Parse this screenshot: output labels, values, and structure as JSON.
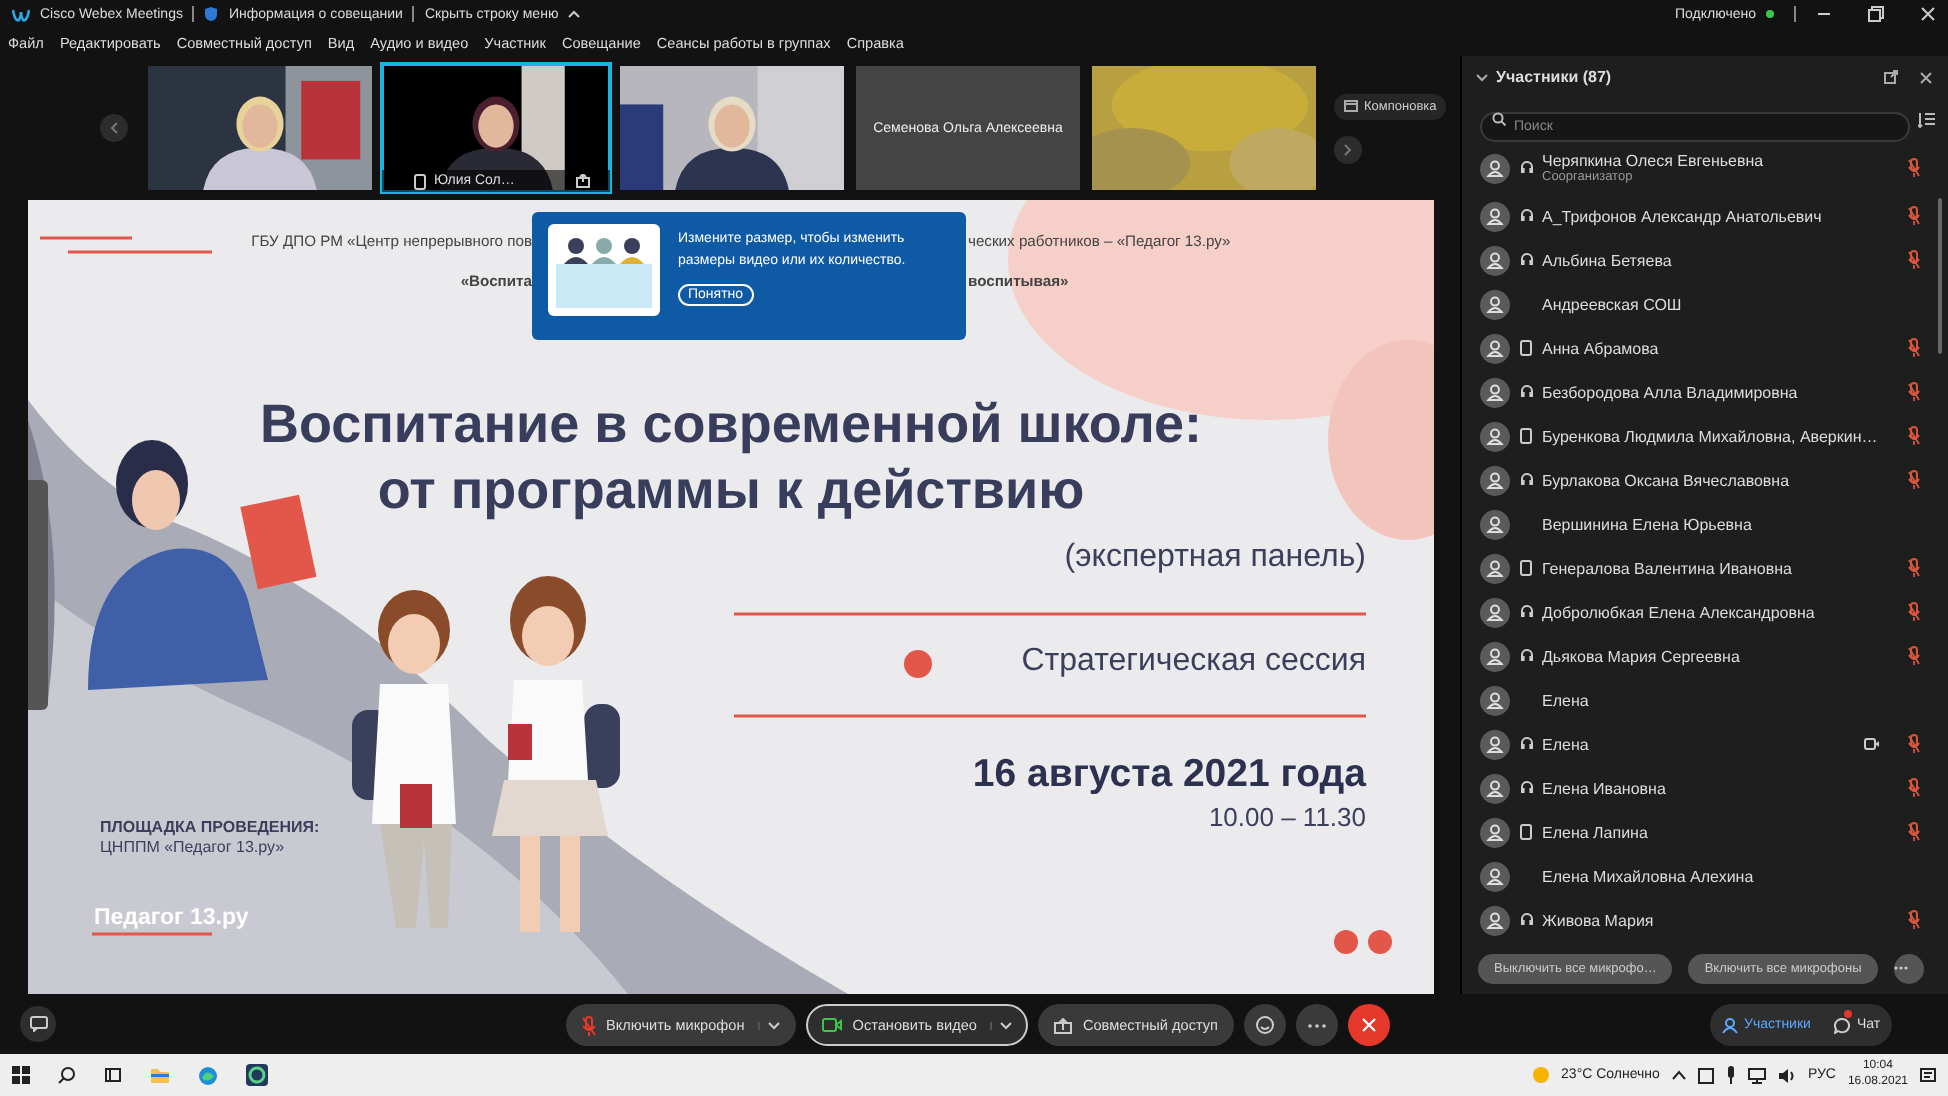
{
  "title_bar": {
    "app": "Cisco Webex Meetings",
    "info": "Информация о совещании",
    "hide_menu": "Скрыть строку меню",
    "status": "Подключено"
  },
  "menu": [
    "Файл",
    "Редактировать",
    "Совместный доступ",
    "Вид",
    "Аудио и видео",
    "Участник",
    "Совещание",
    "Сеансы работы в группах",
    "Справка"
  ],
  "video_strip": {
    "layout_button": "Компоновка",
    "tiles": [
      {
        "kind": "camera",
        "selected": false
      },
      {
        "kind": "camera",
        "selected": true,
        "name": "Юлия Сол…"
      },
      {
        "kind": "camera",
        "selected": false
      },
      {
        "kind": "name",
        "selected": false,
        "name": "Семенова Ольга Алексеевна"
      },
      {
        "kind": "blur",
        "selected": false
      }
    ]
  },
  "notice": {
    "text": "Измените размер, чтобы изменить размеры видео или их количество.",
    "button": "Понятно"
  },
  "slide": {
    "header_left": "ГБУ ДПО РМ «Центр непрерывного пов",
    "header_right": "ческих работников – «Педагог 13.ру»",
    "subheader_left": "«Воспита",
    "subheader_right": "воспитывая»",
    "title": [
      "Воспитание в современной школе:",
      "от программы к действию"
    ],
    "subtitle": "(экспертная панель)",
    "session": "Стратегическая сессия",
    "date": "16 августа 2021 года",
    "time": "10.00 – 11.30",
    "venue_label": "ПЛОЩАДКА ПРОВЕДЕНИЯ:",
    "venue": "ЦНППМ «Педагог 13.ру»",
    "logo": "Педагог 13.ру"
  },
  "participants": {
    "title": "Участники (87)",
    "search_placeholder": "Поиск",
    "items": [
      {
        "name": "Черяпкина Олеся Евгеньевна",
        "role": "Соорганизатор",
        "kind": "headset",
        "muted": true,
        "video": false
      },
      {
        "name": "А_Трифонов Александр Анатольевич",
        "kind": "headset",
        "muted": true,
        "video": false
      },
      {
        "name": "Альбина Бетяева",
        "kind": "headset",
        "muted": true,
        "video": false
      },
      {
        "name": "Андреевская СОШ",
        "kind": "none",
        "muted": false,
        "video": false
      },
      {
        "name": "Анна Абрамова",
        "kind": "phone",
        "muted": true,
        "video": false
      },
      {
        "name": "Безбородова Алла Владимировна",
        "kind": "headset",
        "muted": true,
        "video": false
      },
      {
        "name": "Буренкова Людмила Михайловна, Аверкин…",
        "kind": "phone",
        "muted": true,
        "video": false
      },
      {
        "name": "Бурлакова Оксана Вячеславовна",
        "kind": "headset",
        "muted": true,
        "video": false
      },
      {
        "name": "Вершинина Елена Юрьевна",
        "kind": "none",
        "muted": false,
        "video": false
      },
      {
        "name": "Генералова Валентина Ивановна",
        "kind": "phone",
        "muted": true,
        "video": false
      },
      {
        "name": "Добролюбкая Елена Александровна",
        "kind": "headset",
        "muted": true,
        "video": false
      },
      {
        "name": "Дьякова Мария Сергеевна",
        "kind": "headset",
        "muted": true,
        "video": false
      },
      {
        "name": "Елена",
        "kind": "none",
        "muted": false,
        "video": false
      },
      {
        "name": "Елена",
        "kind": "headset",
        "muted": true,
        "video": true
      },
      {
        "name": "Елена Ивановна",
        "kind": "headset",
        "muted": true,
        "video": false
      },
      {
        "name": "Елена Лапина",
        "kind": "phone",
        "muted": true,
        "video": false
      },
      {
        "name": "Елена Михайловна Алехина",
        "kind": "none",
        "muted": false,
        "video": false
      },
      {
        "name": "Живова Мария",
        "kind": "headset",
        "muted": true,
        "video": false
      }
    ],
    "buttons": [
      "Выключить все микрофо…",
      "Включить все микрофоны"
    ]
  },
  "controls": [
    {
      "kind": "mic",
      "label": "Включить микрофон",
      "focused": false
    },
    {
      "kind": "video",
      "label": "Остановить видео",
      "focused": true
    },
    {
      "kind": "share",
      "label": "Совместный доступ",
      "focused": false
    },
    {
      "kind": "reactions",
      "focused": false
    },
    {
      "kind": "more",
      "focused": false
    },
    {
      "kind": "leave",
      "focused": false
    }
  ],
  "side_tabs": [
    {
      "label": "Участники",
      "selected": true,
      "unread": false
    },
    {
      "label": "Чат",
      "selected": false,
      "unread": true
    }
  ],
  "taskbar": {
    "weather": "23°C Солнечно",
    "lang": "РУС",
    "time": "10:04",
    "date": "16.08.2021"
  }
}
